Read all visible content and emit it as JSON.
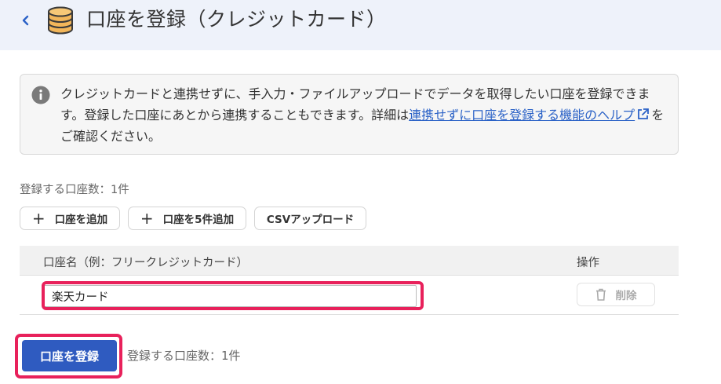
{
  "header": {
    "title": "口座を登録（クレジットカード）",
    "back_icon": "chevron-left-icon",
    "title_icon": "database-icon"
  },
  "info": {
    "icon": "info-icon",
    "text_before": "クレジットカードと連携せずに、手入力・ファイルアップロードでデータを取得したい口座を登録できます。登録した口座にあとから連携することもできます。詳細は",
    "link_text": "連携せずに口座を登録する機能のヘルプ",
    "link_icon": "external-link-icon",
    "text_after": "をご確認ください。"
  },
  "count_label": "登録する口座数：1件",
  "toolbar": {
    "add_label": "口座を追加",
    "add5_label": "口座を5件追加",
    "csv_label": "CSVアップロード"
  },
  "table": {
    "col_name": "口座名（例：フリークレジットカード）",
    "col_op": "操作",
    "rows": [
      {
        "name": "楽天カード",
        "delete_label": "削除"
      }
    ]
  },
  "footer": {
    "submit_label": "口座を登録",
    "count_label": "登録する口座数：1件"
  },
  "colors": {
    "header_bg": "#eef2fa",
    "primary": "#2f5bc0",
    "link": "#2b62c7",
    "highlight": "#e8215b",
    "db_icon": "#f2b65a"
  }
}
